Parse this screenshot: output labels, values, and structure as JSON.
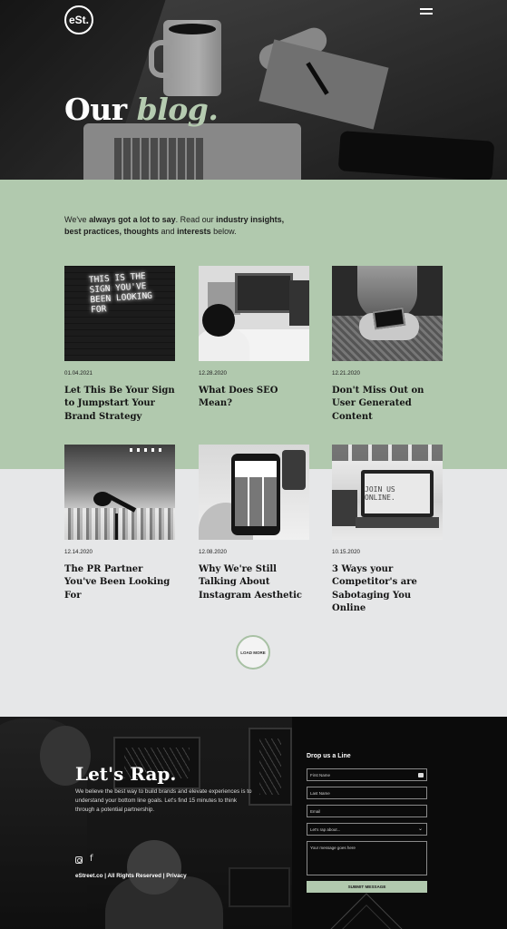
{
  "header": {
    "logo": "eSt.",
    "title_main": "Our",
    "title_accent": "blog."
  },
  "intro": {
    "p1": "We've ",
    "b1": "always got a lot to say",
    "p2": ". Read our ",
    "b2": "industry insights,",
    "b3": "best practices, thoughts",
    "p3": " and ",
    "b4": "interests",
    "p4": " below."
  },
  "posts": [
    {
      "date": "01.04.2021",
      "title": "Let This Be Your Sign to Jumpstart Your Brand Strategy",
      "image_text": "THIS IS THE SIGN YOU'VE BEEN LOOKING FOR"
    },
    {
      "date": "12.28.2020",
      "title": "What Does SEO Mean?"
    },
    {
      "date": "12.21.2020",
      "title": "Don't Miss Out on User Generated Content"
    },
    {
      "date": "12.14.2020",
      "title": "The PR Partner You've Been Looking For"
    },
    {
      "date": "12.08.2020",
      "title": "Why We're Still Talking About Instagram Aesthetic"
    },
    {
      "date": "10.15.2020",
      "title": "3 Ways your Competitor's are Sabotaging You Online",
      "image_text": "JOIN US ONLINE."
    }
  ],
  "load_more": "LOAD MORE",
  "footer": {
    "title": "Let's Rap.",
    "text": "We believe the best way to build brands and elevate experiences is to understand your bottom line goals. Let's find 15 minutes to think through a potential partnership.",
    "legal": "eStreet.co | All Rights Reserved | Privacy",
    "form": {
      "title": "Drop us a Line",
      "first_name": "First Name",
      "last_name": "Last Name",
      "email": "Email",
      "topic": "Let's rap about...",
      "message": "Your message goes here",
      "submit": "SUBMIT MESSAGE"
    }
  },
  "colors": {
    "accent_green": "#b1c9ae",
    "light_bg": "#e6e7e8",
    "dark": "#0b0b0b"
  },
  "icons": [
    "menu-icon",
    "instagram-icon",
    "facebook-icon",
    "chevron-down-icon",
    "contact-card-icon"
  ]
}
